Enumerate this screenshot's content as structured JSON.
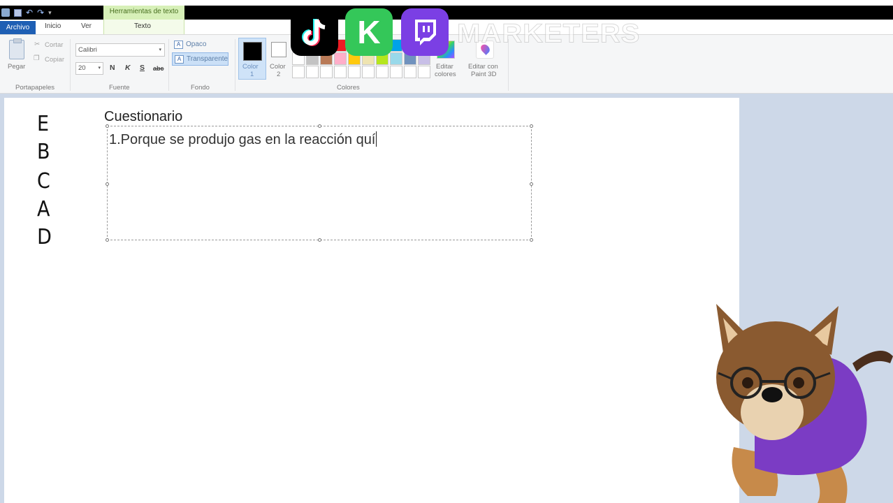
{
  "title_bar": {
    "context_tab_header": "Herramientas de texto"
  },
  "tabs": [
    {
      "label": "Archivo",
      "active": false
    },
    {
      "label": "Inicio",
      "active": false
    },
    {
      "label": "Ver",
      "active": false
    },
    {
      "label": "Texto",
      "active": true
    }
  ],
  "ribbon": {
    "portapapeles": {
      "label": "Portapapeles",
      "paste": "Pegar",
      "cut": "Cortar",
      "copy": "Copiar"
    },
    "fuente": {
      "label": "Fuente",
      "font_family": "Calibri",
      "font_size": "20",
      "bold": "N",
      "italic": "K",
      "underline": "S",
      "strikethrough": "abc"
    },
    "fondo": {
      "label": "Fondo",
      "opaque": "Opaco",
      "transparent": "Transparente",
      "selected": "Transparente"
    },
    "colores": {
      "label": "Colores",
      "color1_label": "Color",
      "color1_num": "1",
      "color2_label": "Color",
      "color2_num": "2",
      "color1_value": "#000000",
      "color2_value": "#ffffff",
      "edit_colors": "Editar",
      "edit_colors_2": "colores",
      "edit_paint3d": "Editar con",
      "edit_paint3d_2": "Paint 3D"
    }
  },
  "canvas": {
    "handwritten_letters": [
      "E",
      "B",
      "C",
      "A",
      "D"
    ],
    "title": "Cuestionario",
    "textbox_text": "1.Porque se produjo gas en la reacción quí"
  },
  "overlays": {
    "app_icons": [
      "tiktok-icon",
      "k-icon",
      "twitch-icon"
    ],
    "k_letter": "K",
    "watermark": "MARKETERS"
  }
}
